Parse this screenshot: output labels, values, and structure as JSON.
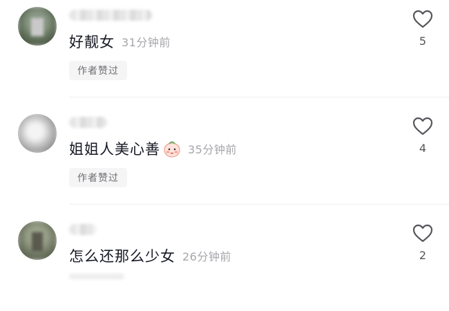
{
  "comments": [
    {
      "content": "好靓女",
      "time": "31分钟前",
      "liked_badge": "作者赞过",
      "likes": "5"
    },
    {
      "content": "姐姐人美心善",
      "time": "35分钟前",
      "liked_badge": "作者赞过",
      "likes": "4",
      "emoji": "shy-face-emoji"
    },
    {
      "content": "怎么还那么少女",
      "time": "26分钟前",
      "likes": "2"
    }
  ],
  "colors": {
    "text": "#161823",
    "muted": "#a6a6ab",
    "badge_bg": "#f5f5f6"
  }
}
